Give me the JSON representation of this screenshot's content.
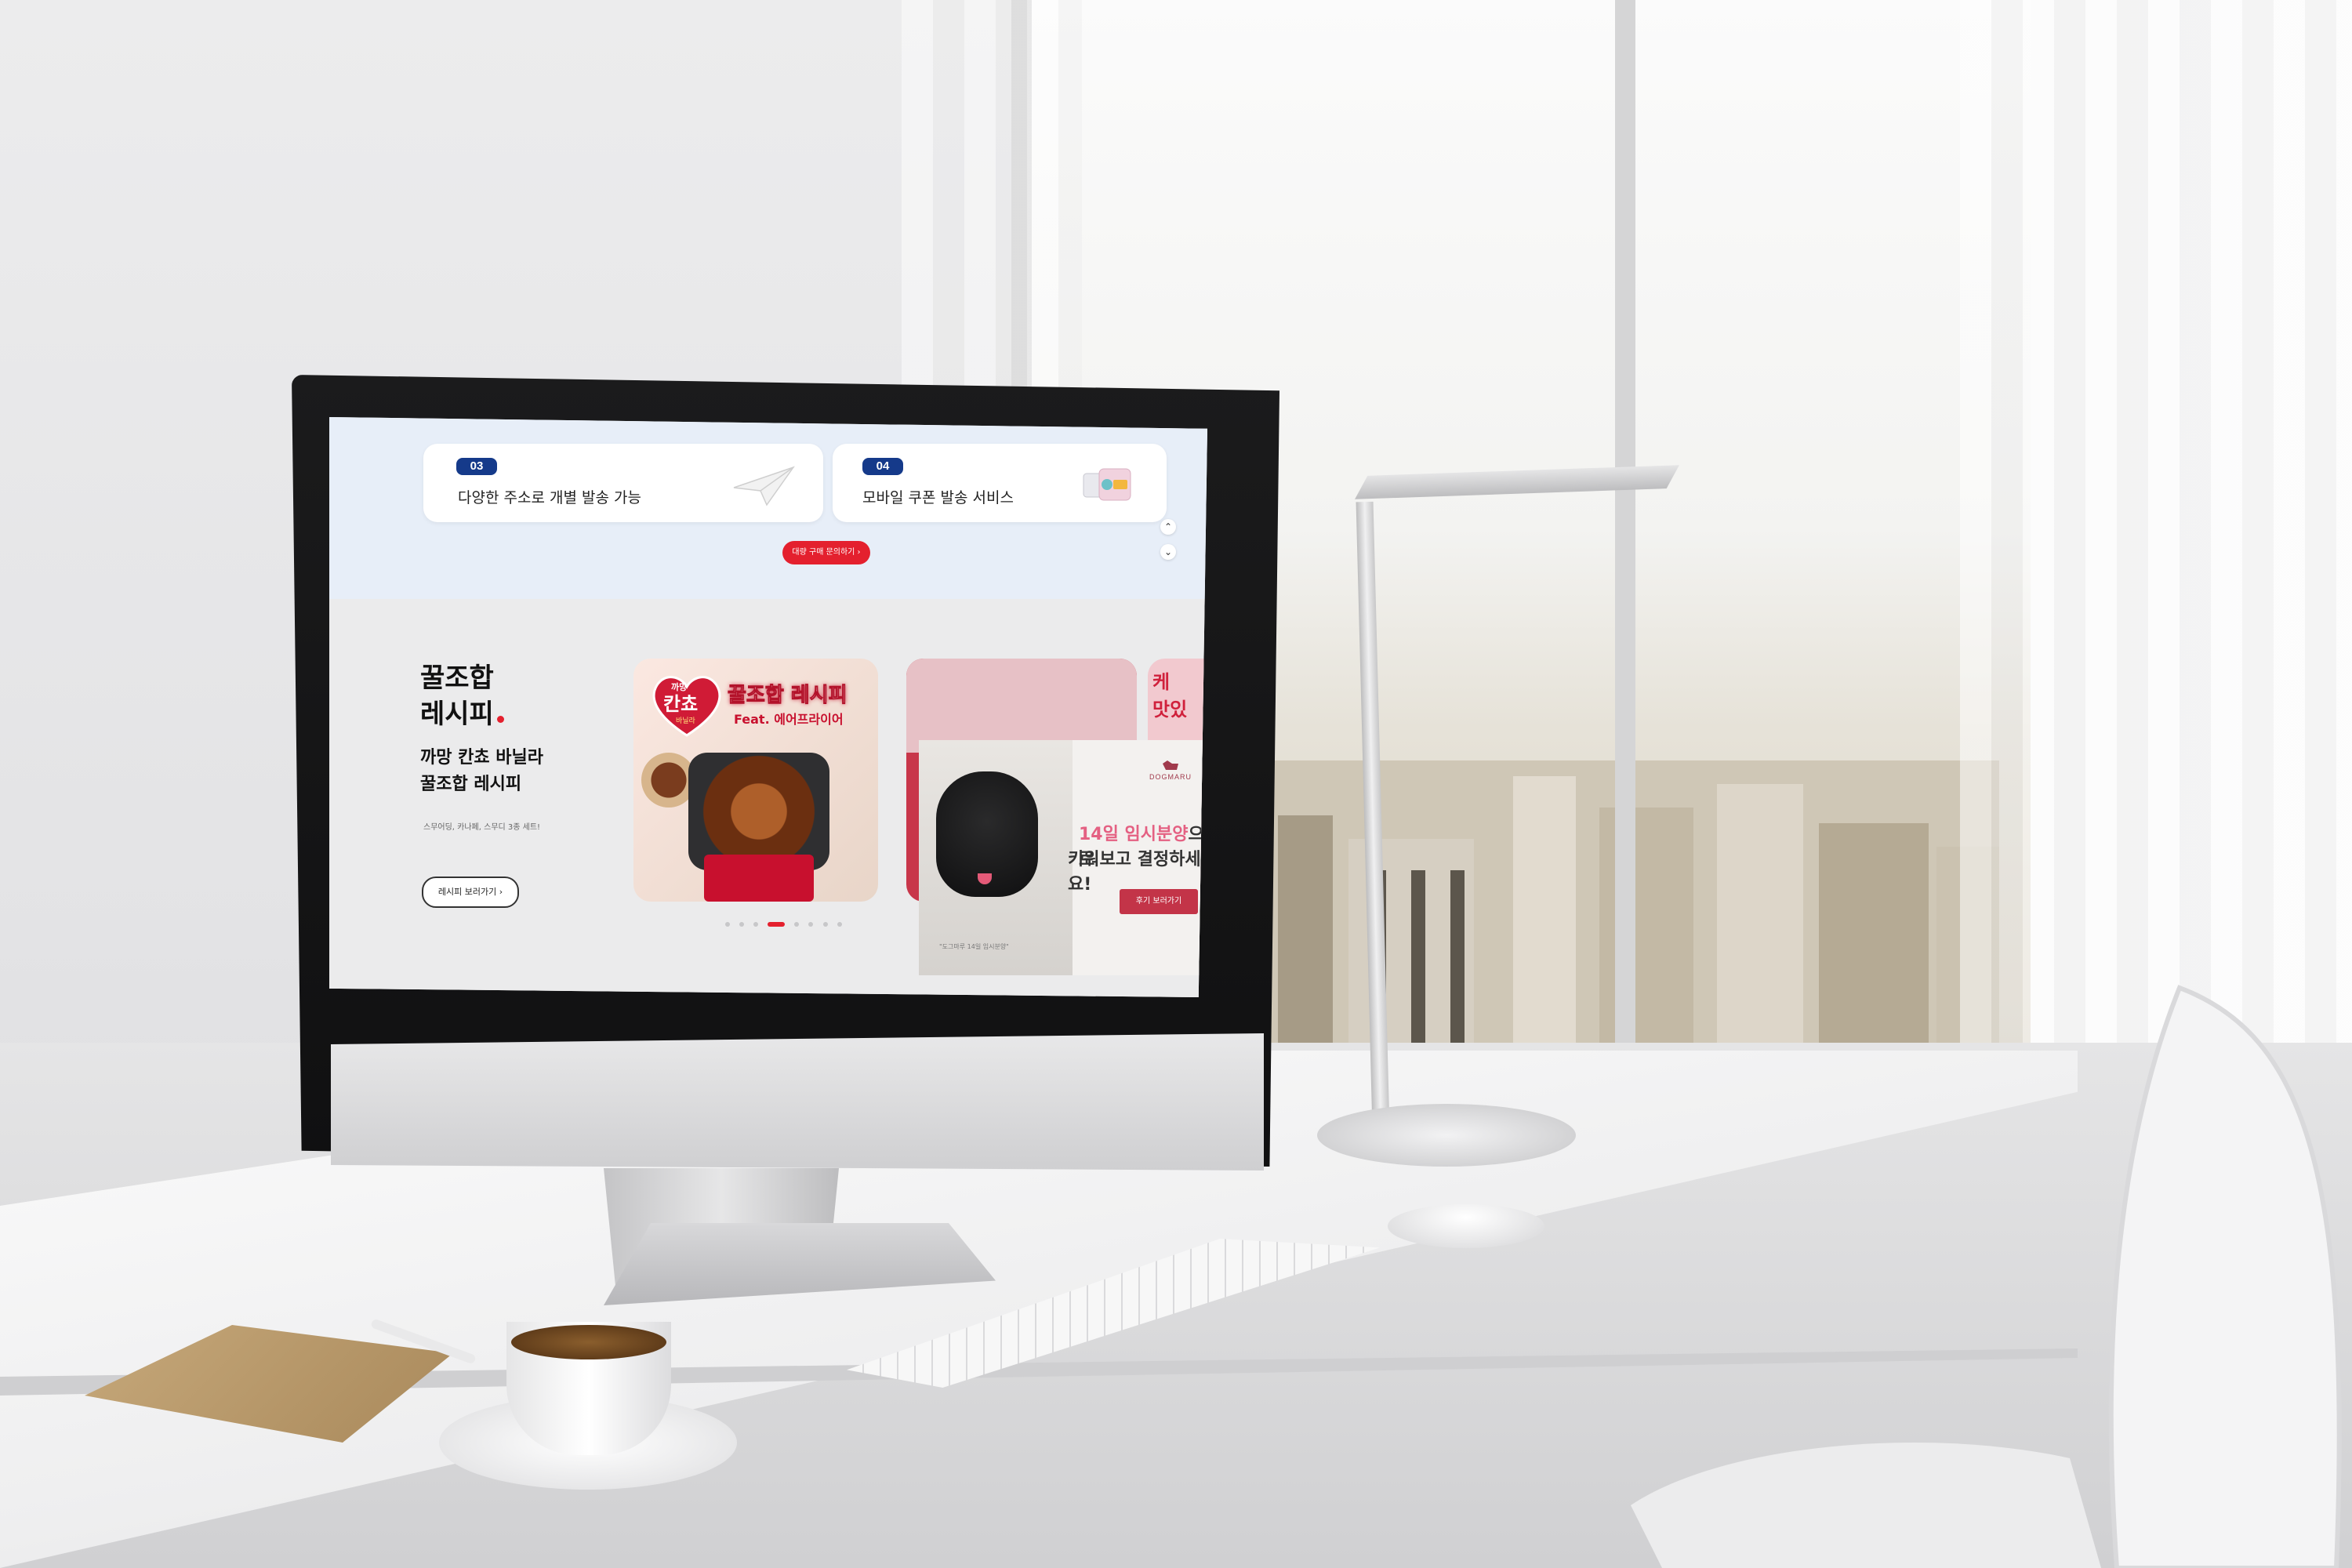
{
  "site": {
    "top": {
      "cards": [
        {
          "number": "03",
          "text": "다양한 주소로 개별 발송 가능",
          "icon": "paper-plane-icon"
        },
        {
          "number": "04",
          "text": "모바일 쿠폰 발송 서비스",
          "icon": "mobile-coupon-icon"
        }
      ],
      "bulk_button": "대량 구매 문의하기  ›",
      "scroll_up": "⌃",
      "scroll_down": "⌄"
    },
    "recipe": {
      "title_line1": "꿀조합",
      "title_line2": "레시피",
      "subtitle_line1": "까망 칸쵸 바닐라",
      "subtitle_line2": "꿀조합 레시피",
      "description": "스무어딩, 카나페, 스무디 3종 세트!",
      "button": "레시피 보러가기  ›",
      "slide1": {
        "logo_top": "까망",
        "logo_main": "칸쵸",
        "logo_sub": "바닐라",
        "header": "꿀조합 레시피",
        "feat": "Feat. 에어프라이어"
      },
      "slide3_text": "케\n맛있"
    },
    "slider_dots": {
      "count": 8,
      "active_index": 3
    },
    "dog_banner": {
      "brand": "DOGMARU",
      "line1_highlight": "14일 임시분양",
      "line1_rest": "으로",
      "line2": "키워보고 결정하세요!",
      "button": "후기 보러가기",
      "caption": "\"도그마루 14일 임시분양\""
    }
  },
  "colors": {
    "accent_red": "#e4202e",
    "badge_blue": "#153a8a",
    "top_bg": "#e7eef8",
    "section_bg": "#ebebec",
    "dog_pink": "#e46082"
  }
}
